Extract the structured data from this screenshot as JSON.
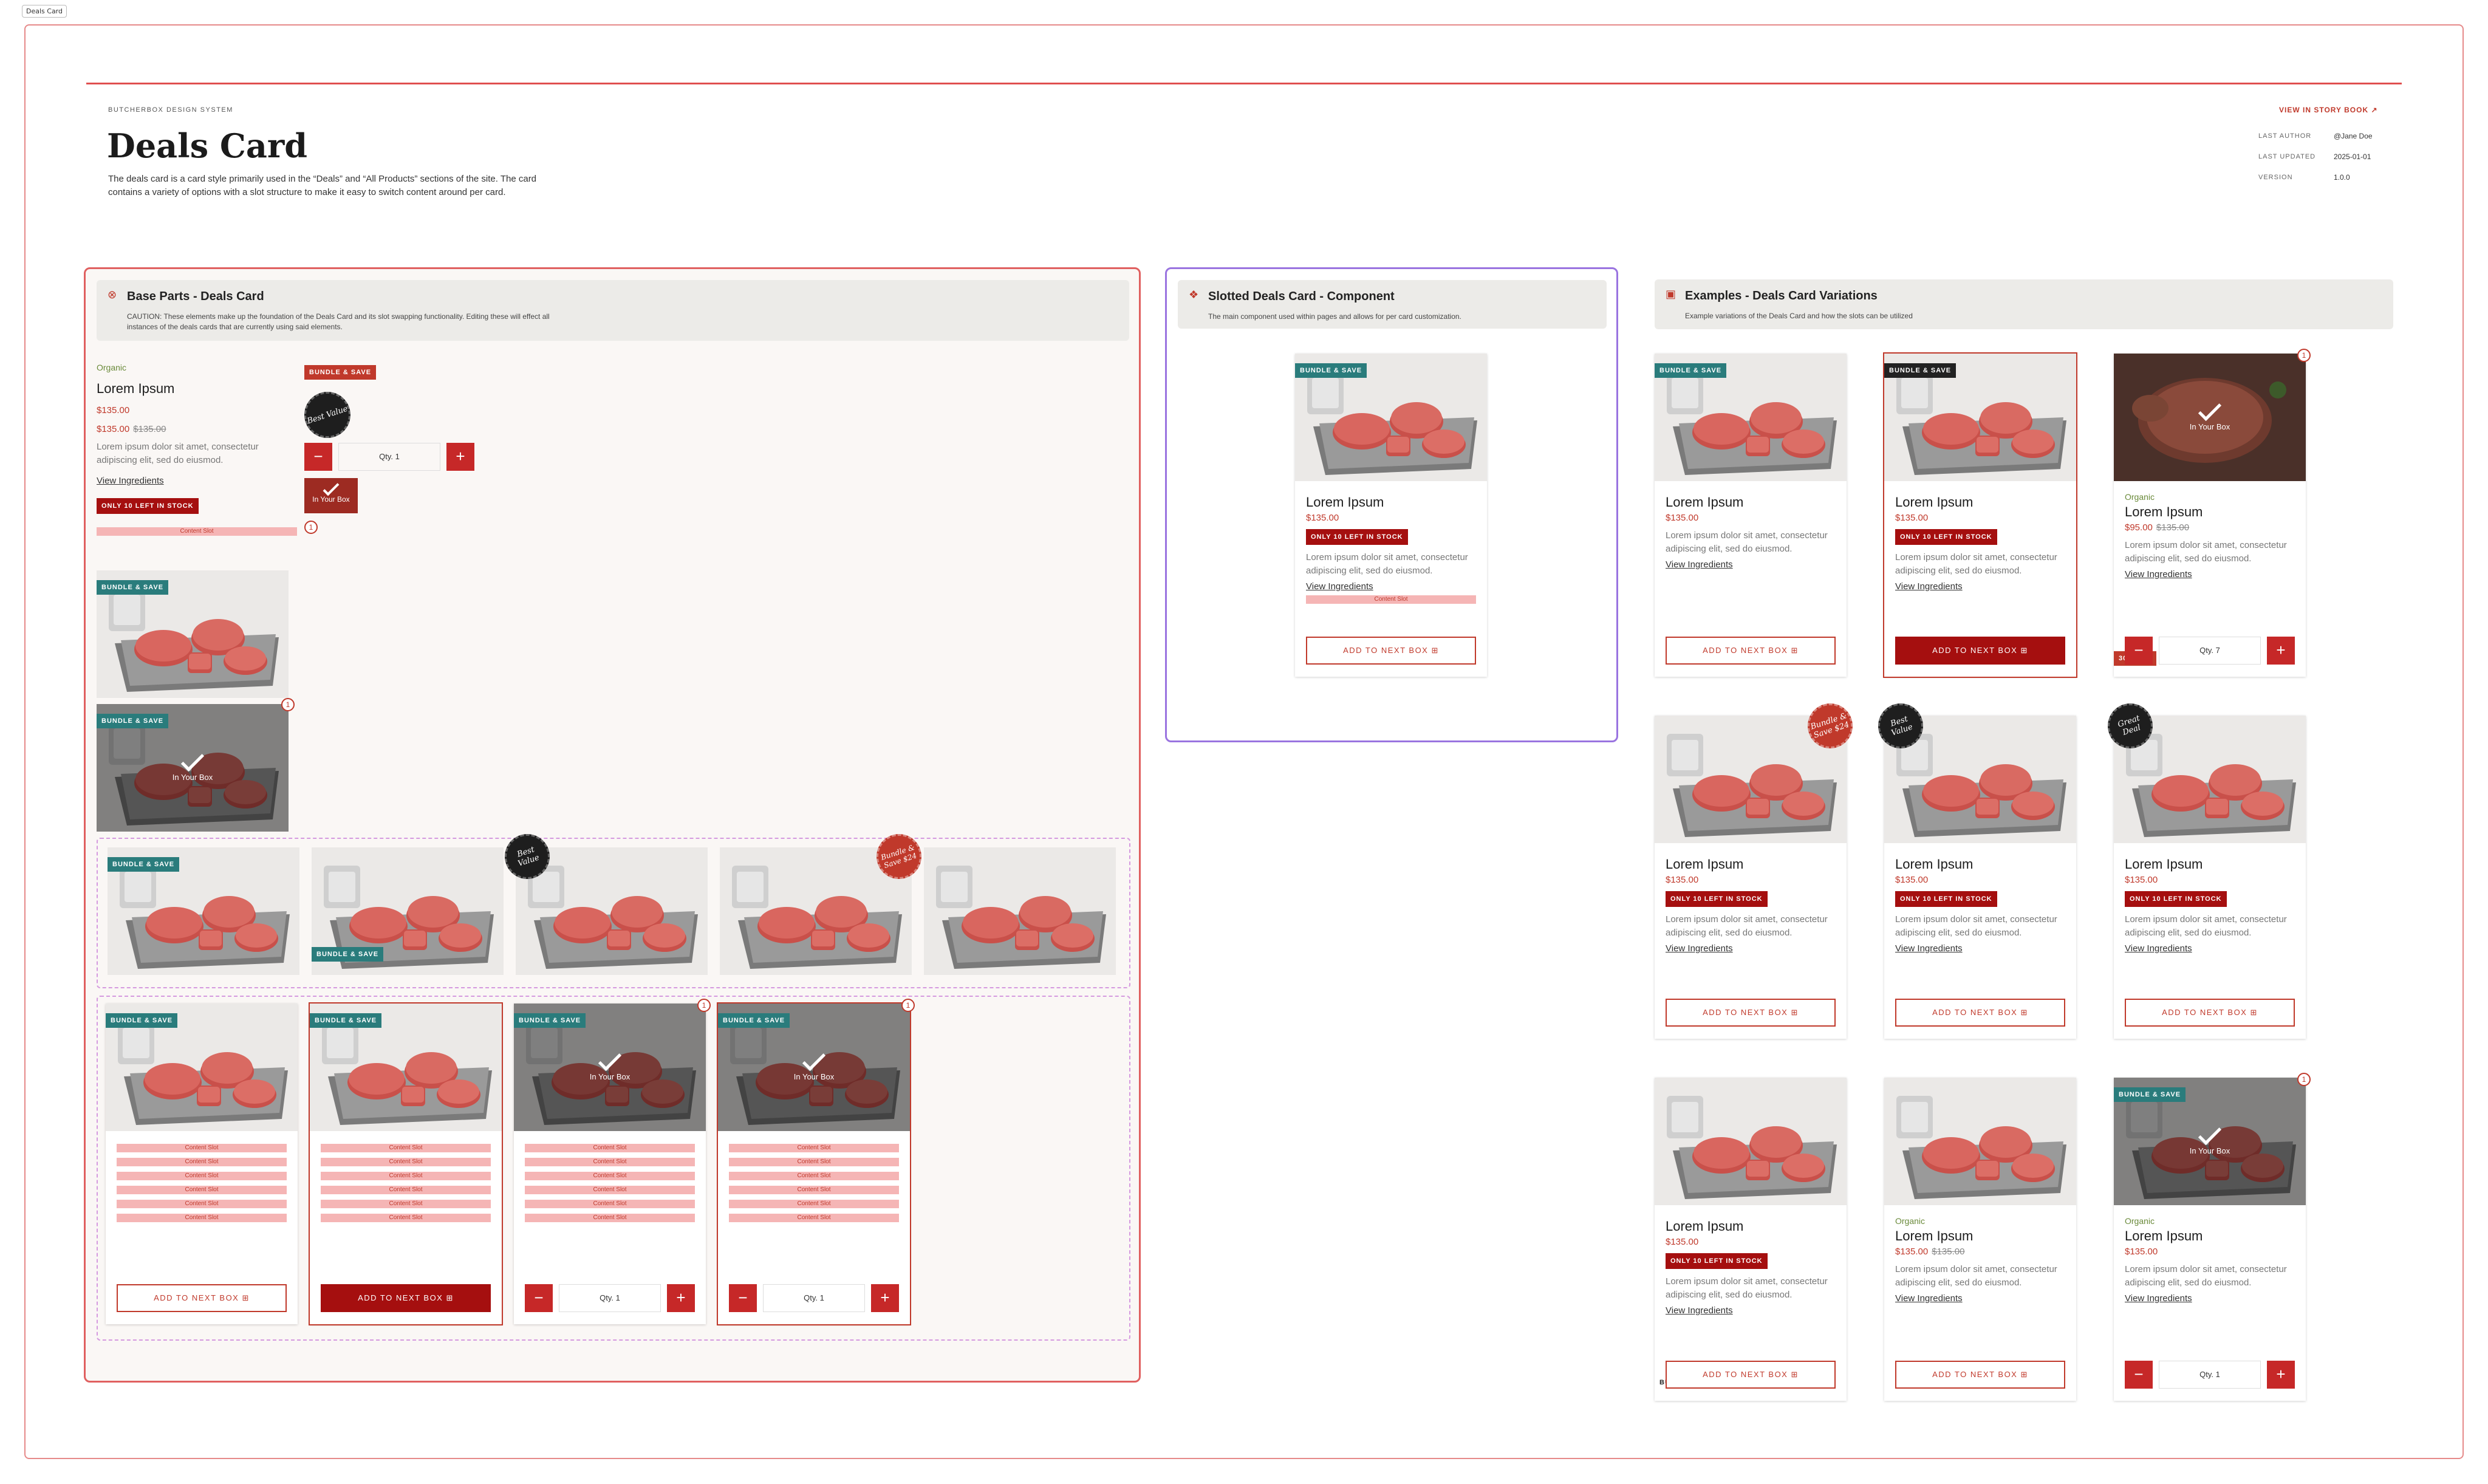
{
  "frame_tag": "Deals Card",
  "header": {
    "system": "BUTCHERBOX DESIGN SYSTEM",
    "title": "Deals Card",
    "description": "The deals card is a card style primarily used in the “Deals” and “All Products” sections of the site. The card contains a variety of options with a slot structure to make it easy to switch content around per card.",
    "storybook": "VIEW IN STORY BOOK",
    "meta": [
      {
        "label": "LAST AUTHOR",
        "value": "@Jane Doe"
      },
      {
        "label": "LAST UPDATED",
        "value": "2025-01-01"
      },
      {
        "label": "VERSION",
        "value": "1.0.0"
      }
    ]
  },
  "sections": {
    "base": {
      "title": "Base Parts - Deals Card",
      "subtitle": "CAUTION: These elements make up the foundation of the Deals Card and its slot swapping functionality. Editing these will effect all instances of the deals cards that are currently using said elements."
    },
    "slotted": {
      "title": "Slotted Deals Card - Component",
      "subtitle": "The main component used within pages and allows for per card customization."
    },
    "examples": {
      "title": "Examples - Deals Card Variations",
      "subtitle": "Example variations of the Deals Card and how the slots can be utilized"
    }
  },
  "common": {
    "organic": "Organic",
    "title": "Lorem Ipsum",
    "price": "$135.00",
    "orig_price": "$135.00",
    "sale_price": "$95.00",
    "desc": "Lorem ipsum dolor sit amet, consectetur adipiscing elit, sed do eiusmod.",
    "view": "View Ingredients",
    "stock": "ONLY 10 LEFT IN STOCK",
    "slot": "Content Slot",
    "bundle": "BUNDLE & SAVE",
    "add": "ADD TO NEXT BOX",
    "in_box": "In Your Box",
    "qty1": "Qty. 1",
    "qty7": "Qty. 7",
    "count": "1",
    "minus": "−",
    "plus": "+",
    "off": "30% OFF",
    "best_value": "Best Value",
    "bundle_save": "Bundle & Save $24",
    "great_deal": "Great Deal"
  }
}
